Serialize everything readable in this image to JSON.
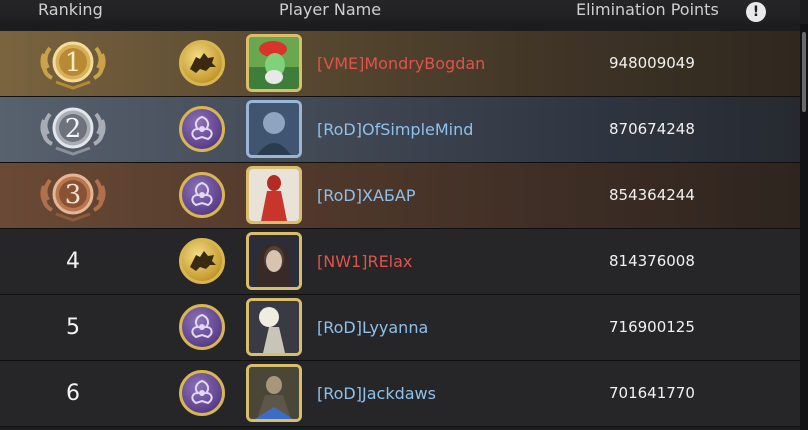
{
  "header": {
    "ranking": "Ranking",
    "player_name": "Player Name",
    "elimination_points": "Elimination Points",
    "info_symbol": "!"
  },
  "rows": [
    {
      "rank": "1",
      "medal": "gold-medal-icon",
      "faction": "direwolf-sigil-icon",
      "name": "[VME]MondryBogdan",
      "name_color": "#e0534b",
      "points": "948009049"
    },
    {
      "rank": "2",
      "medal": "silver-medal-icon",
      "faction": "dragon-sigil-icon",
      "name": "[RoD]OfSimpleMind",
      "name_color": "#8ec1ea",
      "points": "870674248"
    },
    {
      "rank": "3",
      "medal": "bronze-medal-icon",
      "faction": "dragon-sigil-icon",
      "name": "[RoD]ХАБАР",
      "name_color": "#8ec1ea",
      "points": "854364244"
    },
    {
      "rank": "4",
      "faction": "direwolf-sigil-icon",
      "name": "[NW1]RElax",
      "name_color": "#e0534b",
      "points": "814376008"
    },
    {
      "rank": "5",
      "faction": "dragon-sigil-icon",
      "name": "[RoD]Lyyanna",
      "name_color": "#8ec1ea",
      "points": "716900125"
    },
    {
      "rank": "6",
      "faction": "dragon-sigil-icon",
      "name": "[RoD]Jackdaws",
      "name_color": "#8ec1ea",
      "points": "701641770"
    }
  ]
}
